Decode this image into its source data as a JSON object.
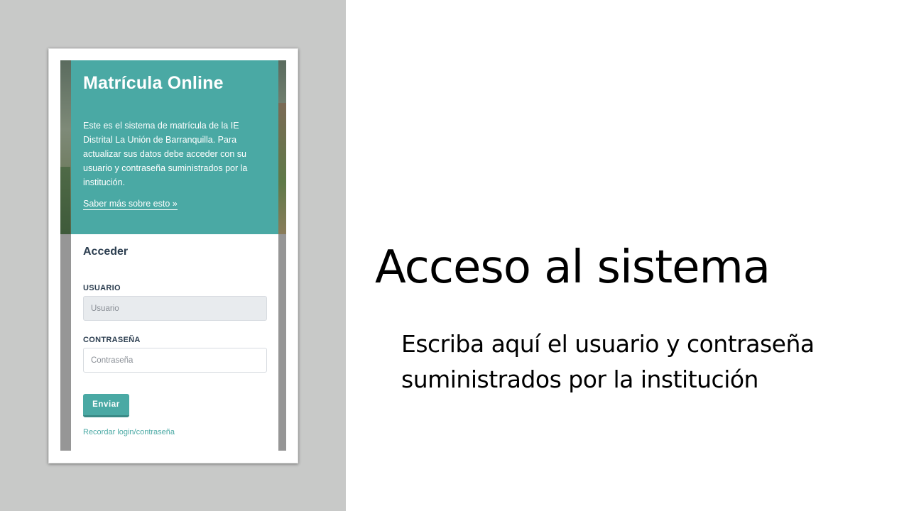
{
  "app": {
    "title": "Matrícula Online",
    "description": "Este es el sistema de matrícula de la IE Distrital La Unión de Barranquilla. Para actualizar sus datos debe acceder con su usuario y contraseña suministrados por la institución.",
    "learn_more_link": "Saber más sobre esto »"
  },
  "login_form": {
    "heading": "Acceder",
    "username": {
      "label": "USUARIO",
      "placeholder": "Usuario",
      "value": ""
    },
    "password": {
      "label": "CONTRASEÑA",
      "placeholder": "Contraseña",
      "value": ""
    },
    "submit_label": "Enviar",
    "recover_link": "Recordar login/contraseña"
  },
  "slide": {
    "title": "Acceso al sistema",
    "body": "Escriba aquí el usuario y contraseña suministrados por la institución"
  },
  "colors": {
    "accent": "#4aa9a4",
    "left_panel_bg": "#c8c9c8",
    "heading_text": "#2c3e50"
  }
}
